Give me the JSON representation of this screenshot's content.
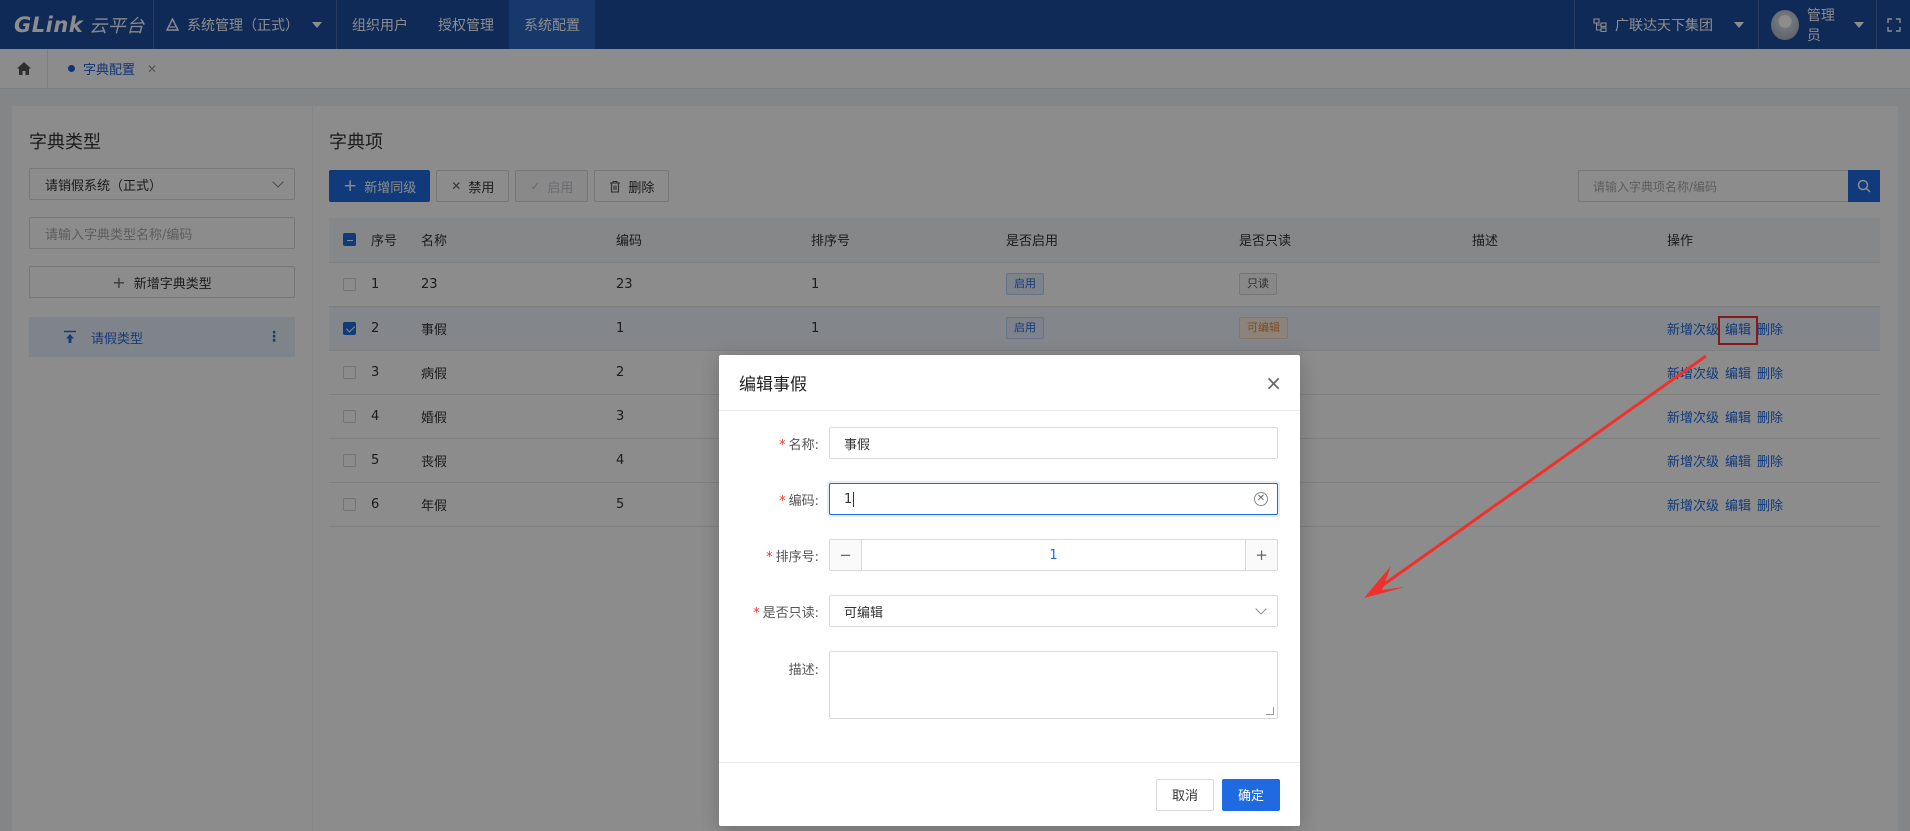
{
  "header": {
    "logo_en": "GLink",
    "logo_cn": "云平台",
    "system": "系统管理（正式）",
    "nav": [
      "组织用户",
      "授权管理",
      "系统配置"
    ],
    "org": "广联达天下集团",
    "user": "管理员"
  },
  "tabbar": {
    "page_tab": "字典配置"
  },
  "left": {
    "title": "字典类型",
    "system_select": "请销假系统（正式）",
    "search_placeholder": "请输入字典类型名称/编码",
    "add_type": "新增字典类型",
    "tree_item": "请假类型"
  },
  "right": {
    "title": "字典项",
    "toolbar": {
      "add_sibling": "新增同级",
      "disable": "禁用",
      "enable": "启用",
      "delete": "删除"
    },
    "search_placeholder": "请输入字典项名称/编码",
    "columns": [
      "序号",
      "名称",
      "编码",
      "排序号",
      "是否启用",
      "是否只读",
      "描述",
      "操作"
    ],
    "rows": [
      {
        "no": "1",
        "name": "23",
        "code": "23",
        "sort": "1",
        "enabled": "启用",
        "readonly": "只读",
        "checked": false
      },
      {
        "no": "2",
        "name": "事假",
        "code": "1",
        "sort": "1",
        "enabled": "启用",
        "readonly": "可编辑",
        "checked": true
      },
      {
        "no": "3",
        "name": "病假",
        "code": "2",
        "sort": "",
        "enabled": "",
        "readonly": "",
        "checked": false
      },
      {
        "no": "4",
        "name": "婚假",
        "code": "3",
        "sort": "",
        "enabled": "",
        "readonly": "",
        "checked": false
      },
      {
        "no": "5",
        "name": "丧假",
        "code": "4",
        "sort": "",
        "enabled": "",
        "readonly": "",
        "checked": false
      },
      {
        "no": "6",
        "name": "年假",
        "code": "5",
        "sort": "",
        "enabled": "",
        "readonly": "",
        "checked": false
      }
    ],
    "ops": {
      "add_child": "新增次级",
      "edit": "编辑",
      "delete": "删除"
    }
  },
  "modal": {
    "title": "编辑事假",
    "fields": {
      "name_label": "名称:",
      "name_value": "事假",
      "code_label": "编码:",
      "code_value": "1",
      "sort_label": "排序号:",
      "sort_value": "1",
      "readonly_label": "是否只读:",
      "readonly_value": "可编辑",
      "desc_label": "描述:"
    },
    "cancel": "取消",
    "confirm": "确定"
  },
  "colors": {
    "header": "#1e4ea0",
    "primary": "#1f6ae0",
    "annotation": "#f0302a"
  }
}
